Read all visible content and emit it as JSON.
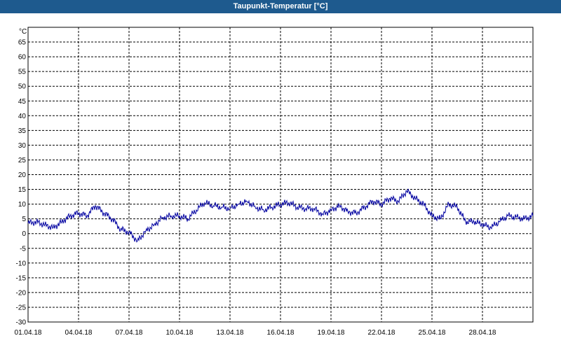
{
  "window": {
    "title": "Taupunkt-Temperatur [°C]"
  },
  "colors": {
    "titlebar": "#1e5a8e",
    "line": "#0000a0",
    "grid": "#000000",
    "background": "#ffffff"
  },
  "chart_data": {
    "type": "line",
    "title": "Taupunkt-Temperatur [°C]",
    "ylabel": "°C",
    "xlabel": "",
    "ylim": [
      -30,
      70
    ],
    "yticks": [
      65,
      60,
      55,
      50,
      45,
      40,
      35,
      30,
      25,
      20,
      15,
      10,
      5,
      0,
      -5,
      -10,
      -15,
      -20,
      -25,
      -30
    ],
    "xlim": [
      "2018-04-01",
      "2018-05-01"
    ],
    "xticks": [
      "01.04.18",
      "04.04.18",
      "07.04.18",
      "10.04.18",
      "13.04.18",
      "16.04.18",
      "19.04.18",
      "22.04.18",
      "25.04.18",
      "28.04.18"
    ],
    "grid": true,
    "legend": "none",
    "series": [
      {
        "x": [
          "2018-04-01",
          "2018-04-01 12:00",
          "2018-04-02",
          "2018-04-02 12:00",
          "2018-04-03",
          "2018-04-03 12:00",
          "2018-04-04",
          "2018-04-04 12:00",
          "2018-04-05",
          "2018-04-05 12:00",
          "2018-04-06",
          "2018-04-06 12:00",
          "2018-04-07",
          "2018-04-07 12:00",
          "2018-04-08",
          "2018-04-08 12:00",
          "2018-04-09",
          "2018-04-09 12:00",
          "2018-04-10",
          "2018-04-10 12:00",
          "2018-04-11",
          "2018-04-11 12:00",
          "2018-04-12",
          "2018-04-12 12:00",
          "2018-04-13",
          "2018-04-13 12:00",
          "2018-04-14",
          "2018-04-14 12:00",
          "2018-04-15",
          "2018-04-15 12:00",
          "2018-04-16",
          "2018-04-16 12:00",
          "2018-04-17",
          "2018-04-17 12:00",
          "2018-04-18",
          "2018-04-18 12:00",
          "2018-04-19",
          "2018-04-19 12:00",
          "2018-04-20",
          "2018-04-20 12:00",
          "2018-04-21",
          "2018-04-21 12:00",
          "2018-04-22",
          "2018-04-22 12:00",
          "2018-04-23",
          "2018-04-23 12:00",
          "2018-04-24",
          "2018-04-24 12:00",
          "2018-04-25",
          "2018-04-25 12:00",
          "2018-04-26",
          "2018-04-26 12:00",
          "2018-04-27",
          "2018-04-27 12:00",
          "2018-04-28",
          "2018-04-28 12:00",
          "2018-04-29",
          "2018-04-29 12:00",
          "2018-04-30",
          "2018-04-30 12:00",
          "2018-05-01"
        ],
        "values": [
          3.5,
          4,
          3,
          2,
          4,
          6,
          7,
          6,
          9.5,
          7,
          5,
          1.5,
          0.5,
          -2.5,
          1,
          3,
          5.5,
          6,
          6,
          5,
          8,
          10.5,
          9.5,
          9,
          8.5,
          10,
          11,
          9,
          8,
          9,
          10,
          10.5,
          9,
          8.5,
          8.5,
          6.5,
          8,
          9.5,
          7.5,
          7,
          9,
          11,
          10,
          12,
          11,
          14.5,
          12,
          10,
          6,
          5,
          10,
          9,
          4,
          4,
          3,
          2,
          4,
          6,
          5.5,
          5,
          6
        ]
      }
    ]
  }
}
